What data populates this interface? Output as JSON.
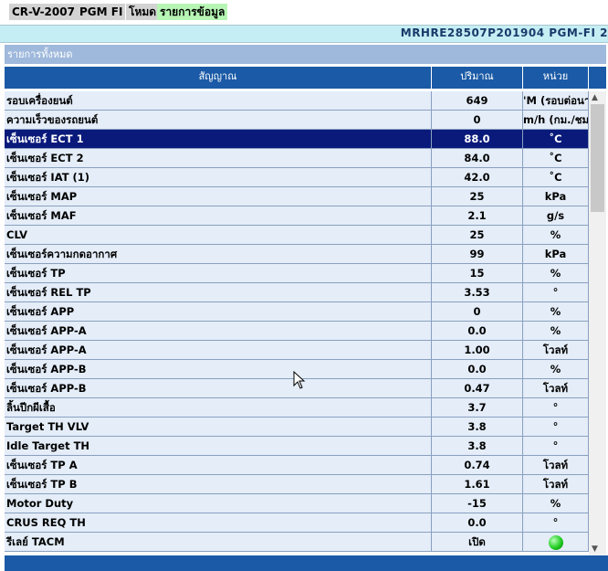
{
  "breadcrumb": {
    "model": "CR-V-2007",
    "system": "PGM FI",
    "mode": "โหมด",
    "section": "รายการข้อมูล"
  },
  "vin_text": "MRHRE28507P201904  PGM-FI  2",
  "list_title": "รายการทั้งหมด",
  "columns": {
    "name": "สัญญาณ",
    "value": "ปริมาณ",
    "unit": "หน่วย"
  },
  "rows": [
    {
      "name": "รอบเครื่องยนต์",
      "value": "649",
      "unit": "'M (รอบต่อนาที)"
    },
    {
      "name": "ความเร็วของรถยนต์",
      "value": "0",
      "unit": "m/h (กม./ชม.)"
    },
    {
      "name": "เซ็นเซอร์ ECT 1",
      "value": "88.0",
      "unit": "˚C"
    },
    {
      "name": "เซ็นเซอร์ ECT 2",
      "value": "84.0",
      "unit": "˚C"
    },
    {
      "name": "เซ็นเซอร์ IAT (1)",
      "value": "42.0",
      "unit": "˚C"
    },
    {
      "name": "เซ็นเซอร์ MAP",
      "value": "25",
      "unit": "kPa"
    },
    {
      "name": "เซ็นเซอร์ MAF",
      "value": "2.1",
      "unit": "g/s"
    },
    {
      "name": "CLV",
      "value": "25",
      "unit": "%"
    },
    {
      "name": "เซ็นเซอร์ความกดอากาศ",
      "value": "99",
      "unit": "kPa"
    },
    {
      "name": "เซ็นเซอร์ TP",
      "value": "15",
      "unit": "%"
    },
    {
      "name": "เซ็นเซอร์ REL TP",
      "value": "3.53",
      "unit": "°"
    },
    {
      "name": "เซ็นเซอร์ APP",
      "value": "0",
      "unit": "%"
    },
    {
      "name": "เซ็นเซอร์ APP-A",
      "value": "0.0",
      "unit": "%"
    },
    {
      "name": "เซ็นเซอร์ APP-A",
      "value": "1.00",
      "unit": "โวลท์"
    },
    {
      "name": "เซ็นเซอร์ APP-B",
      "value": "0.0",
      "unit": "%"
    },
    {
      "name": "เซ็นเซอร์ APP-B",
      "value": "0.47",
      "unit": "โวลท์"
    },
    {
      "name": "ลิ้นปีกผีเสื้อ",
      "value": "3.7",
      "unit": "°"
    },
    {
      "name": "Target TH VLV",
      "value": "3.8",
      "unit": "°"
    },
    {
      "name": "Idle Target TH",
      "value": "3.8",
      "unit": "°"
    },
    {
      "name": "เซ็นเซอร์ TP A",
      "value": "0.74",
      "unit": "โวลท์"
    },
    {
      "name": "เซ็นเซอร์ TP B",
      "value": "1.61",
      "unit": "โวลท์"
    },
    {
      "name": "Motor Duty",
      "value": "-15",
      "unit": "%"
    },
    {
      "name": "CRUS REQ TH",
      "value": "0.0",
      "unit": "°"
    },
    {
      "name": "รีเลย์ TACM",
      "value": "เปิด",
      "unit": ""
    }
  ],
  "selected_row": 2,
  "status_led_color": "#22cc22",
  "colors": {
    "header": "#1a5aa6",
    "selected": "#0a1a7a",
    "row_bg": "#e4edf8"
  }
}
